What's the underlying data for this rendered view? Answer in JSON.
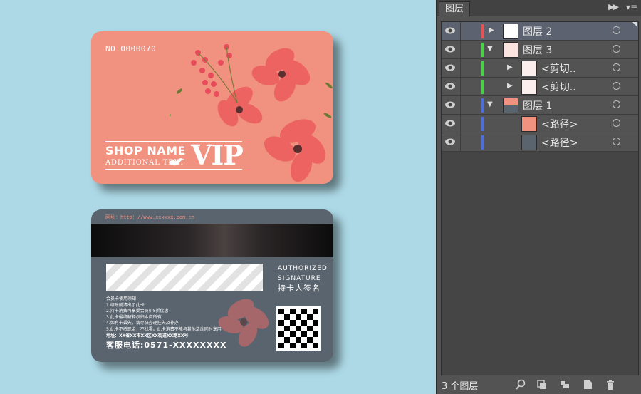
{
  "front_card": {
    "card_number": "NO.0000070",
    "shop_name": "SHOP NAME",
    "additional_text": "ADDITIONAL TEXT",
    "vip": "VIP"
  },
  "back_card": {
    "website": "网址：http：//www.xxxxxx.com.cn",
    "authorized": "AUTHORIZED",
    "signature": "SIGNATURE",
    "signature_cn": "持卡人签名",
    "notice_lines": [
      "会员卡使用须知：",
      "1.结账前请出示此卡",
      "2.持卡消费可享受会员价8折优惠",
      "3.此卡最终解释权归本店所有",
      "4.如有卡丢失，请尽快办理挂失及补办",
      "5.此卡不抵现金，不找零。此卡消费不能与其他活动同时享用"
    ],
    "address": "地址：XX省XX市XX区XX街道XX路XX号",
    "hotline": "客服电话:0571-XXXXXXXX"
  },
  "layers_panel": {
    "tab_label": "图层",
    "layers": [
      {
        "name": "图层 2",
        "color": "#e05555",
        "expand": "collapsed",
        "selected": true
      },
      {
        "name": "图层 3",
        "color": "#4ccf4c",
        "expand": "expanded",
        "selected": false
      },
      {
        "name": "<剪切..",
        "color": "#4ccf4c",
        "expand": "collapsed",
        "selected": false
      },
      {
        "name": "<剪切..",
        "color": "#4ccf4c",
        "expand": "collapsed",
        "selected": false
      },
      {
        "name": "图层 1",
        "color": "#4f6fd6",
        "expand": "expanded",
        "selected": false
      },
      {
        "name": "<路径>",
        "color": "#4f6fd6",
        "expand": "none",
        "selected": false
      },
      {
        "name": "<路径>",
        "color": "#4f6fd6",
        "expand": "none",
        "selected": false
      }
    ],
    "layer_count": "3 个图层",
    "footer_icons": [
      "search-icon",
      "make-clip-mask-icon",
      "new-sublayer-icon",
      "new-layer-icon",
      "trash-icon"
    ]
  }
}
